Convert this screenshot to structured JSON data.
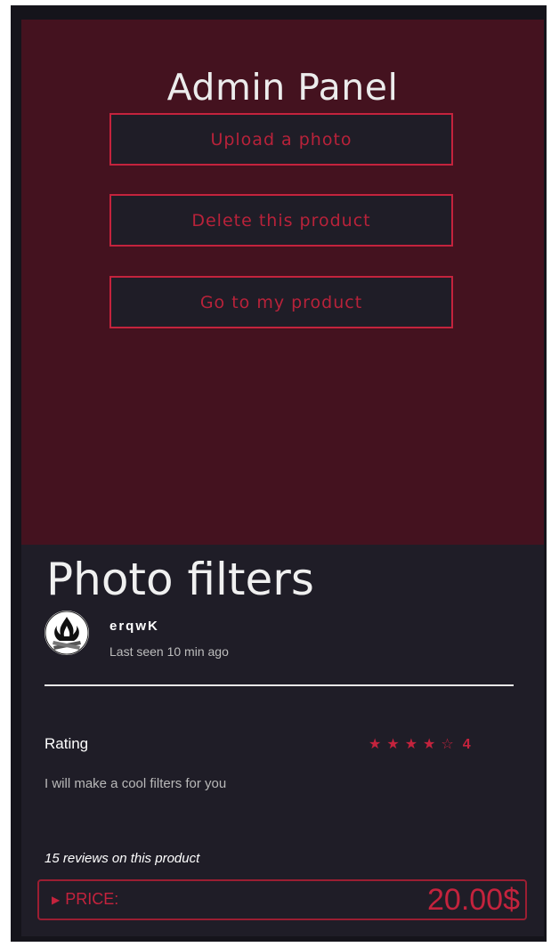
{
  "admin_panel": {
    "title": "Admin Panel",
    "buttons": {
      "upload": "Upload a photo",
      "delete": "Delete this product",
      "goto": "Go to my product"
    }
  },
  "product": {
    "title": "Photo filters",
    "seller": {
      "name": "erqwK",
      "last_seen": "Last seen 10 min ago",
      "avatar_icon": "campfire-logo-icon"
    },
    "rating": {
      "label": "Rating",
      "stars_filled": 4,
      "stars_total": 5,
      "value": "4"
    },
    "description": "I will make a cool filters for you",
    "reviews_text": "15 reviews on this product",
    "price": {
      "label": "PRICE:",
      "value": "20.00$"
    }
  },
  "colors": {
    "accent": "#c4233d",
    "admin_bg": "#44121f",
    "card_bg": "#1f1d27"
  }
}
